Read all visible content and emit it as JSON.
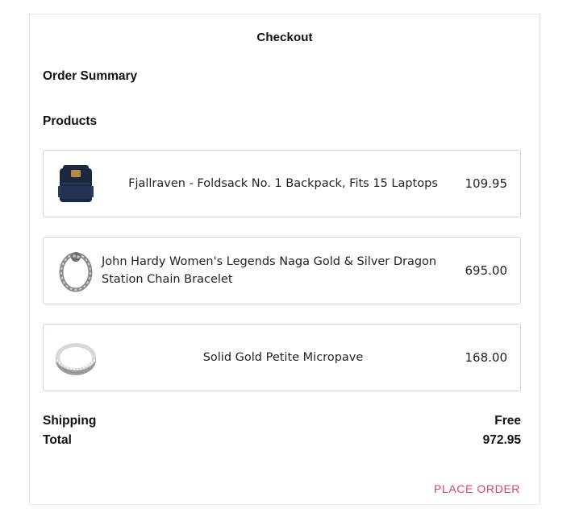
{
  "checkout": {
    "title": "Checkout",
    "order_summary_label": "Order Summary",
    "products_label": "Products",
    "products": [
      {
        "name": "Fjallraven - Foldsack No. 1 Backpack, Fits 15 Laptops",
        "price": "109.95",
        "image_icon": "backpack-image"
      },
      {
        "name": "John Hardy Women's Legends Naga Gold & Silver Dragon Station Chain Bracelet",
        "price": "695.00",
        "image_icon": "bracelet-image"
      },
      {
        "name": "Solid Gold Petite Micropave",
        "price": "168.00",
        "image_icon": "ring-image"
      }
    ],
    "shipping_label": "Shipping",
    "shipping_value": "Free",
    "total_label": "Total",
    "total_value": "972.95",
    "place_order_label": "PLACE ORDER",
    "accent_color": "#e3425e"
  }
}
